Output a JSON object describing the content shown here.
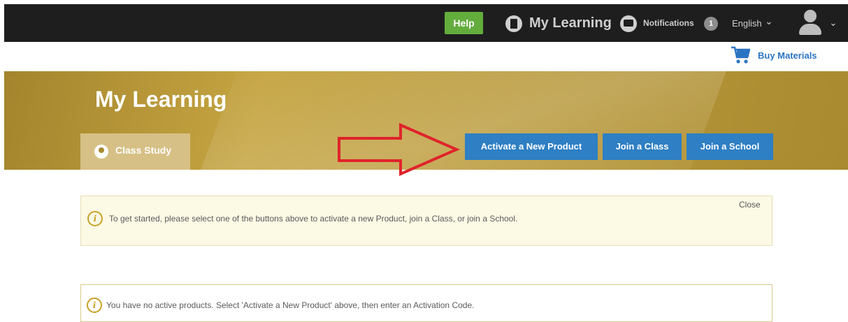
{
  "topbar": {
    "help_label": "Help",
    "my_learning_label": "My Learning",
    "notifications_label": "Notifications",
    "notifications_count": "1",
    "language": "English"
  },
  "subheader": {
    "buy_label": "Buy Materials"
  },
  "banner": {
    "title": "My Learning",
    "tab_label": "Class Study",
    "buttons": {
      "activate": "Activate a New Product",
      "join_class": "Join a Class",
      "join_school": "Join a School"
    }
  },
  "alerts": {
    "getting_started": {
      "text": "To get started, please select one of the buttons above to activate a new Product, join a Class, or join a School.",
      "close_label": "Close"
    },
    "no_products": {
      "text": "You have no active products. Select 'Activate a New Product' above, then enter an Activation Code."
    }
  },
  "icons": {
    "book": "book-icon",
    "notifications": "megaphone-icon",
    "cart": "cart-icon",
    "avatar": "user-avatar-icon",
    "class_study": "class-study-icon",
    "info": "info-icon"
  },
  "colors": {
    "topbar": "#1e1e1e",
    "help": "#63ad3d",
    "primary": "#2e7fc4",
    "banner": "#b9993a",
    "link": "#2b74c2",
    "arrow": "#e0232a"
  }
}
